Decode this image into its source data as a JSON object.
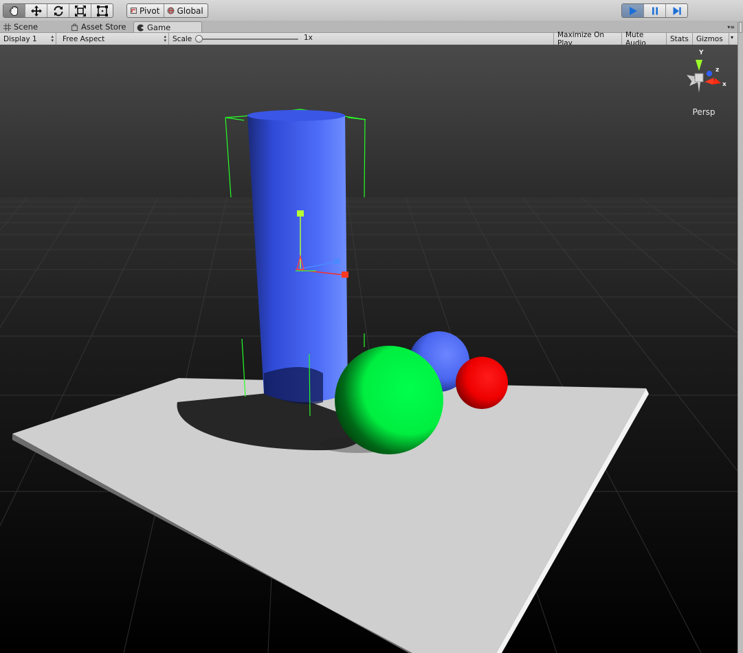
{
  "toolbar": {
    "tools": [
      {
        "name": "hand-tool",
        "icon": "hand-icon"
      },
      {
        "name": "move-tool",
        "icon": "move-icon"
      },
      {
        "name": "rotate-tool",
        "icon": "rotate-icon"
      },
      {
        "name": "scale-tool",
        "icon": "scale-icon"
      },
      {
        "name": "rect-tool",
        "icon": "rect-icon"
      }
    ],
    "pivot_label": "Pivot",
    "global_label": "Global",
    "playback": [
      "play-icon",
      "pause-icon",
      "step-icon"
    ]
  },
  "tabs": [
    {
      "label": "Scene",
      "icon": "grid-icon",
      "active": false
    },
    {
      "label": "Asset Store",
      "icon": "bag-icon",
      "active": false
    },
    {
      "label": "Game",
      "icon": "pacman-icon",
      "active": true
    }
  ],
  "gamebar": {
    "display": "Display 1",
    "aspect": "Free Aspect",
    "scale_label": "Scale",
    "scale_value": "1x",
    "maximize": "Maximize On Play",
    "mute": "Mute Audio",
    "stats": "Stats",
    "gizmos": "Gizmos"
  },
  "scene": {
    "gizmo_labels": {
      "y": "Y",
      "z": "z",
      "x": "x"
    },
    "persp_label": "Persp",
    "colors": {
      "cylinder": "#4a6cf5",
      "green_sphere": "#00ff44",
      "blue_sphere": "#4a6cf5",
      "red_sphere": "#ff0000",
      "plane": "#cfcfcf",
      "selection": "#26ff26"
    }
  }
}
